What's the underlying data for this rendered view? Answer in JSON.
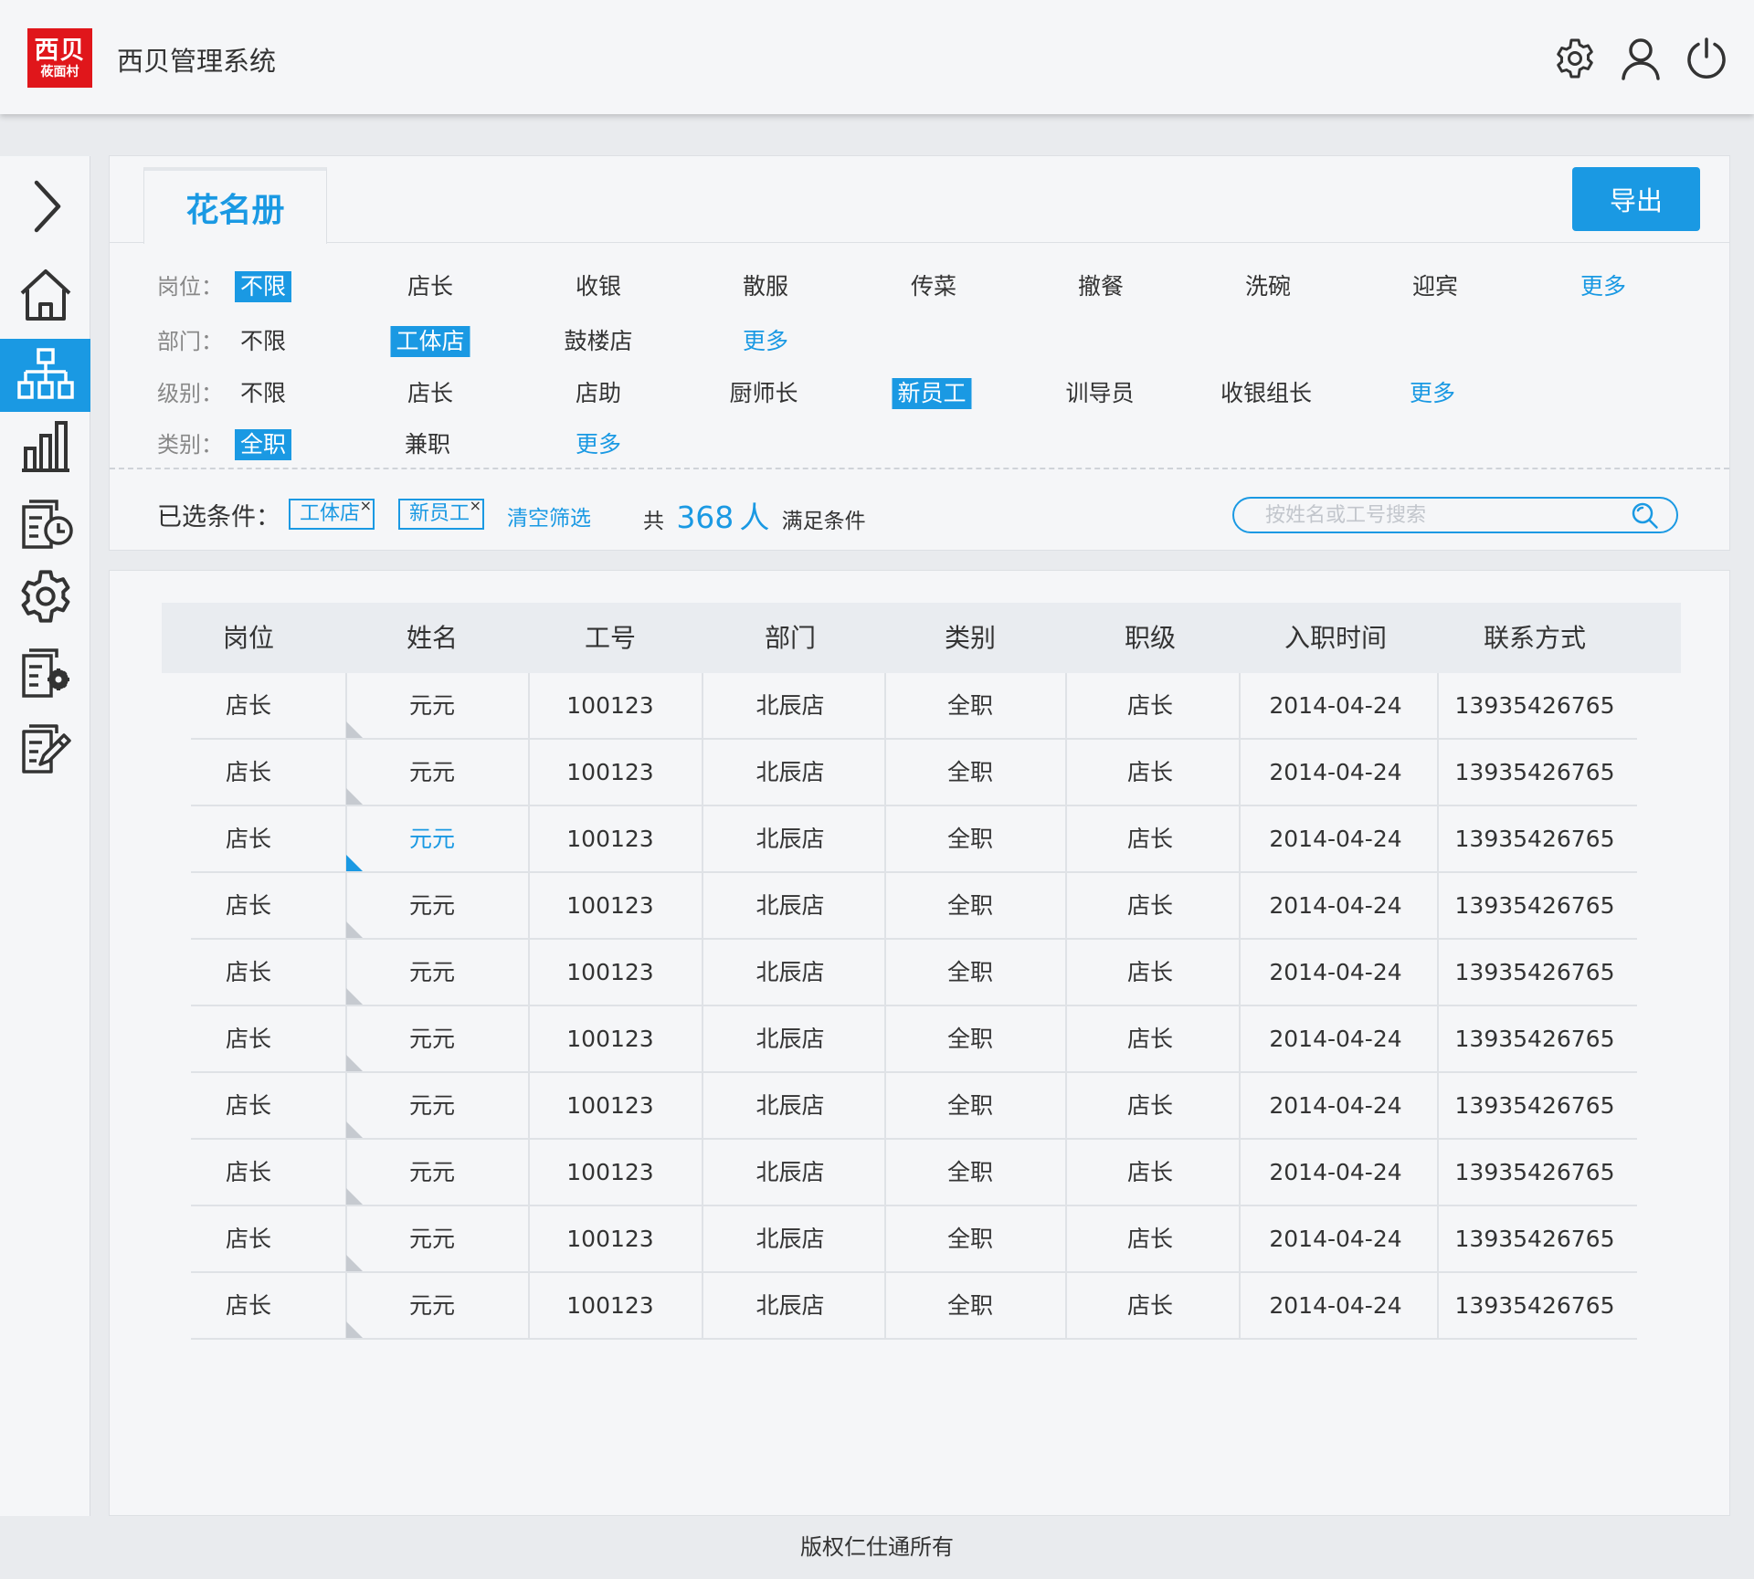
{
  "header": {
    "logo_line1": "西贝",
    "logo_line2": "莜面村",
    "app_title": "西贝管理系统",
    "icons": [
      "gear-icon",
      "user-icon",
      "power-icon"
    ]
  },
  "sidebar": {
    "items": [
      "expand-icon",
      "home-icon",
      "org-chart-icon",
      "bar-chart-icon",
      "schedule-icon",
      "settings-icon",
      "doc-settings-icon",
      "edit-doc-icon"
    ],
    "active": "org-chart-icon"
  },
  "tab": {
    "label": "花名册"
  },
  "export_label": "导出",
  "filters": {
    "position": {
      "label": "岗位：",
      "options": [
        "不限",
        "店长",
        "收银",
        "散服",
        "传菜",
        "撤餐",
        "洗碗",
        "迎宾",
        "更多"
      ],
      "selected": "不限"
    },
    "department": {
      "label": "部门：",
      "options": [
        "不限",
        "工体店",
        "鼓楼店",
        "更多"
      ],
      "selected": "工体店"
    },
    "level": {
      "label": "级别：",
      "options": [
        "不限",
        "店长",
        "店助",
        "厨师长",
        "新员工",
        "训导员",
        "收银组长",
        "更多"
      ],
      "selected": "新员工"
    },
    "category": {
      "label": "类别：",
      "options": [
        "全职",
        "兼职",
        "更多"
      ],
      "selected": "全职"
    }
  },
  "selection": {
    "label": "已选条件：",
    "chips": [
      "工体店",
      "新员工"
    ],
    "clear_label": "清空筛选",
    "count_prefix": "共",
    "count": "368",
    "count_unit": "人",
    "count_suffix": "满足条件"
  },
  "search": {
    "placeholder": "按姓名或工号搜索"
  },
  "table": {
    "columns": [
      "岗位",
      "姓名",
      "工号",
      "部门",
      "类别",
      "职级",
      "入职时间",
      "联系方式"
    ],
    "rows": [
      [
        "店长",
        "元元",
        "100123",
        "北辰店",
        "全职",
        "店长",
        "2014-04-24",
        "13935426765"
      ],
      [
        "店长",
        "元元",
        "100123",
        "北辰店",
        "全职",
        "店长",
        "2014-04-24",
        "13935426765"
      ],
      [
        "店长",
        "元元",
        "100123",
        "北辰店",
        "全职",
        "店长",
        "2014-04-24",
        "13935426765"
      ],
      [
        "店长",
        "元元",
        "100123",
        "北辰店",
        "全职",
        "店长",
        "2014-04-24",
        "13935426765"
      ],
      [
        "店长",
        "元元",
        "100123",
        "北辰店",
        "全职",
        "店长",
        "2014-04-24",
        "13935426765"
      ],
      [
        "店长",
        "元元",
        "100123",
        "北辰店",
        "全职",
        "店长",
        "2014-04-24",
        "13935426765"
      ],
      [
        "店长",
        "元元",
        "100123",
        "北辰店",
        "全职",
        "店长",
        "2014-04-24",
        "13935426765"
      ],
      [
        "店长",
        "元元",
        "100123",
        "北辰店",
        "全职",
        "店长",
        "2014-04-24",
        "13935426765"
      ],
      [
        "店长",
        "元元",
        "100123",
        "北辰店",
        "全职",
        "店长",
        "2014-04-24",
        "13935426765"
      ],
      [
        "店长",
        "元元",
        "100123",
        "北辰店",
        "全职",
        "店长",
        "2014-04-24",
        "13935426765"
      ]
    ],
    "highlighted_row": 2
  },
  "footer": {
    "text": "版权仁仕通所有"
  },
  "colors": {
    "accent": "#1a99e3",
    "logo_red": "#e0161b",
    "background": "#e9ebee",
    "panel": "#f5f6f8"
  }
}
